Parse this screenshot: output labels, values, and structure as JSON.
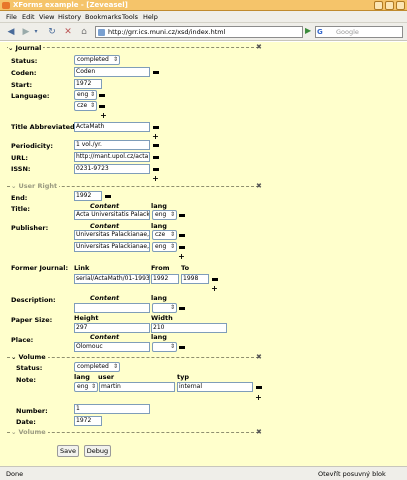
{
  "window": {
    "title": "XForms example - [Zeveasel]"
  },
  "menu": [
    "File",
    "Edit",
    "View",
    "History",
    "Bookmarks",
    "Tools",
    "Help"
  ],
  "nav": {
    "url": "http://grr.ics.muni.cz/xsd/index.html",
    "search_placeholder": "Google"
  },
  "journal": {
    "section_title": "Journal",
    "status_label": "Status:",
    "status_value": "completed",
    "coden_label": "Coden:",
    "coden_value": "Coden",
    "start_label": "Start:",
    "start_value": "1972",
    "language_label": "Language:",
    "language_values": [
      "eng",
      "cze"
    ],
    "title_abbr_label": "Title Abbreviated:",
    "title_abbr_value": "ActaMath",
    "periodicity_label": "Periodicity:",
    "periodicity_value": "1 vol./yr.",
    "url_label": "URL:",
    "url_value": "http://mant.upol.cz/acta",
    "issn_label": "ISSN:",
    "issn_value": "0231-9723"
  },
  "user_right": {
    "section_title": "User Right",
    "end_label": "End:",
    "end_value": "1992",
    "title_label": "Title:",
    "content_hdr": "Content",
    "lang_hdr": "lang",
    "title_value": "Acta Universitatis Palackianae",
    "title_lang": "eng",
    "publisher_label": "Publisher:",
    "publishers": [
      {
        "value": "Universitas Palackianae, Olo",
        "lang": "cze"
      },
      {
        "value": "Universitas Palackianae, Olo",
        "lang": "eng"
      }
    ],
    "former_label": "Former Journal:",
    "link_hdr": "Link",
    "from_hdr": "From",
    "to_hdr": "To",
    "former_link": "serial/ActaMath/01-1993-1",
    "former_from": "1992",
    "former_to": "1998",
    "description_label": "Description:",
    "description_lang": "",
    "paper_label": "Paper Size:",
    "height_hdr": "Height",
    "width_hdr": "Width",
    "paper_height": "297",
    "paper_width": "210",
    "place_label": "Place:",
    "place_value": "Olomouc",
    "place_lang": ""
  },
  "volume": {
    "section_title": "Volume",
    "status_label": "Status:",
    "status_value": "completed",
    "note_label": "Note:",
    "lang_hdr": "lang",
    "user_hdr": "user",
    "typ_hdr": "typ",
    "note_lang": "eng",
    "note_user": "martin",
    "note_typ": "internal",
    "number_label": "Number:",
    "number_value": "1",
    "date_label": "Date:",
    "date_value": "1972",
    "footer_title": "Volume"
  },
  "buttons": {
    "save": "Save",
    "debug": "Debug"
  },
  "status": {
    "left": "Done",
    "right": "Otevřít posuvný blok"
  }
}
